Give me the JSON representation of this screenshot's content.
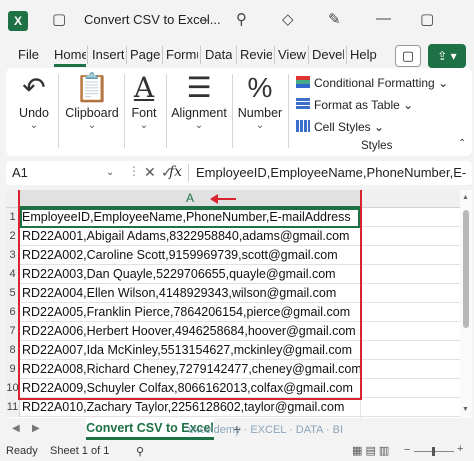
{
  "app": {
    "title": "Convert CSV to Excel...",
    "logo_letter": "X",
    "icons": [
      "excel-logo",
      "save-icon",
      "undo-icon",
      "redo-icon",
      "user-icon",
      "diamond-icon",
      "pen-icon",
      "minimize-icon",
      "restore-icon"
    ]
  },
  "menu": {
    "tabs": [
      "File",
      "Home",
      "Insert",
      "Page l",
      "Formu",
      "Data",
      "Revie",
      "View",
      "Devel",
      "Help"
    ],
    "active": "Home",
    "comment_glyph": "▢",
    "share_glyph": "⇪ ▾"
  },
  "ribbon": {
    "undo_label": "Undo",
    "clipboard_label": "Clipboard",
    "font_label": "Font",
    "alignment_label": "Alignment",
    "number_label": "Number",
    "conditional_formatting": "Conditional Formatting",
    "format_as_table": "Format as Table",
    "cell_styles": "Cell Styles",
    "styles_group": "Styles",
    "number_icon": "%",
    "font_icon": "A",
    "chev": "⌄"
  },
  "formula_bar": {
    "name_box": "A1",
    "fx": "fx",
    "content": "EmployeeID,EmployeeName,PhoneNumber,E-"
  },
  "grid": {
    "column_header": "A",
    "rows": [
      {
        "num": "1",
        "value": "EmployeeID,EmployeeName,PhoneNumber,E-mailAddress"
      },
      {
        "num": "2",
        "value": "RD22A001,Abigail Adams,8322958840,adams@gmail.com"
      },
      {
        "num": "3",
        "value": "RD22A002,Caroline Scott,9159969739,scott@gmail.com"
      },
      {
        "num": "4",
        "value": "RD22A003,Dan Quayle,5229706655,quayle@gmail.com"
      },
      {
        "num": "5",
        "value": "RD22A004,Ellen Wilson,4148929343,wilson@gmail.com"
      },
      {
        "num": "6",
        "value": "RD22A005,Franklin Pierce,7864206154,pierce@gmail.com"
      },
      {
        "num": "7",
        "value": "RD22A006,Herbert Hoover,4946258684,hoover@gmail.com"
      },
      {
        "num": "8",
        "value": "RD22A007,Ida McKinley,5513154627,mckinley@gmail.com"
      },
      {
        "num": "9",
        "value": "RD22A008,Richard Cheney,7279142477,cheney@gmail.com"
      },
      {
        "num": "10",
        "value": "RD22A009,Schuyler Colfax,8066162013,colfax@gmail.com"
      },
      {
        "num": "11",
        "value": "RD22A010,Zachary Taylor,2256128602,taylor@gmail.com"
      }
    ]
  },
  "sheets": {
    "active": "Convert CSV to Excel",
    "add_glyph": "+"
  },
  "status": {
    "ready": "Ready",
    "sheet": "Sheet 1 of 1",
    "accessibility_glyph": "⚲",
    "zoom_minus": "−",
    "zoom_plus": "+"
  },
  "watermark": "exceldemy · EXCEL · DATA · BI",
  "colors": {
    "excel_green": "#1e7145",
    "highlight_red": "#d9232e"
  }
}
